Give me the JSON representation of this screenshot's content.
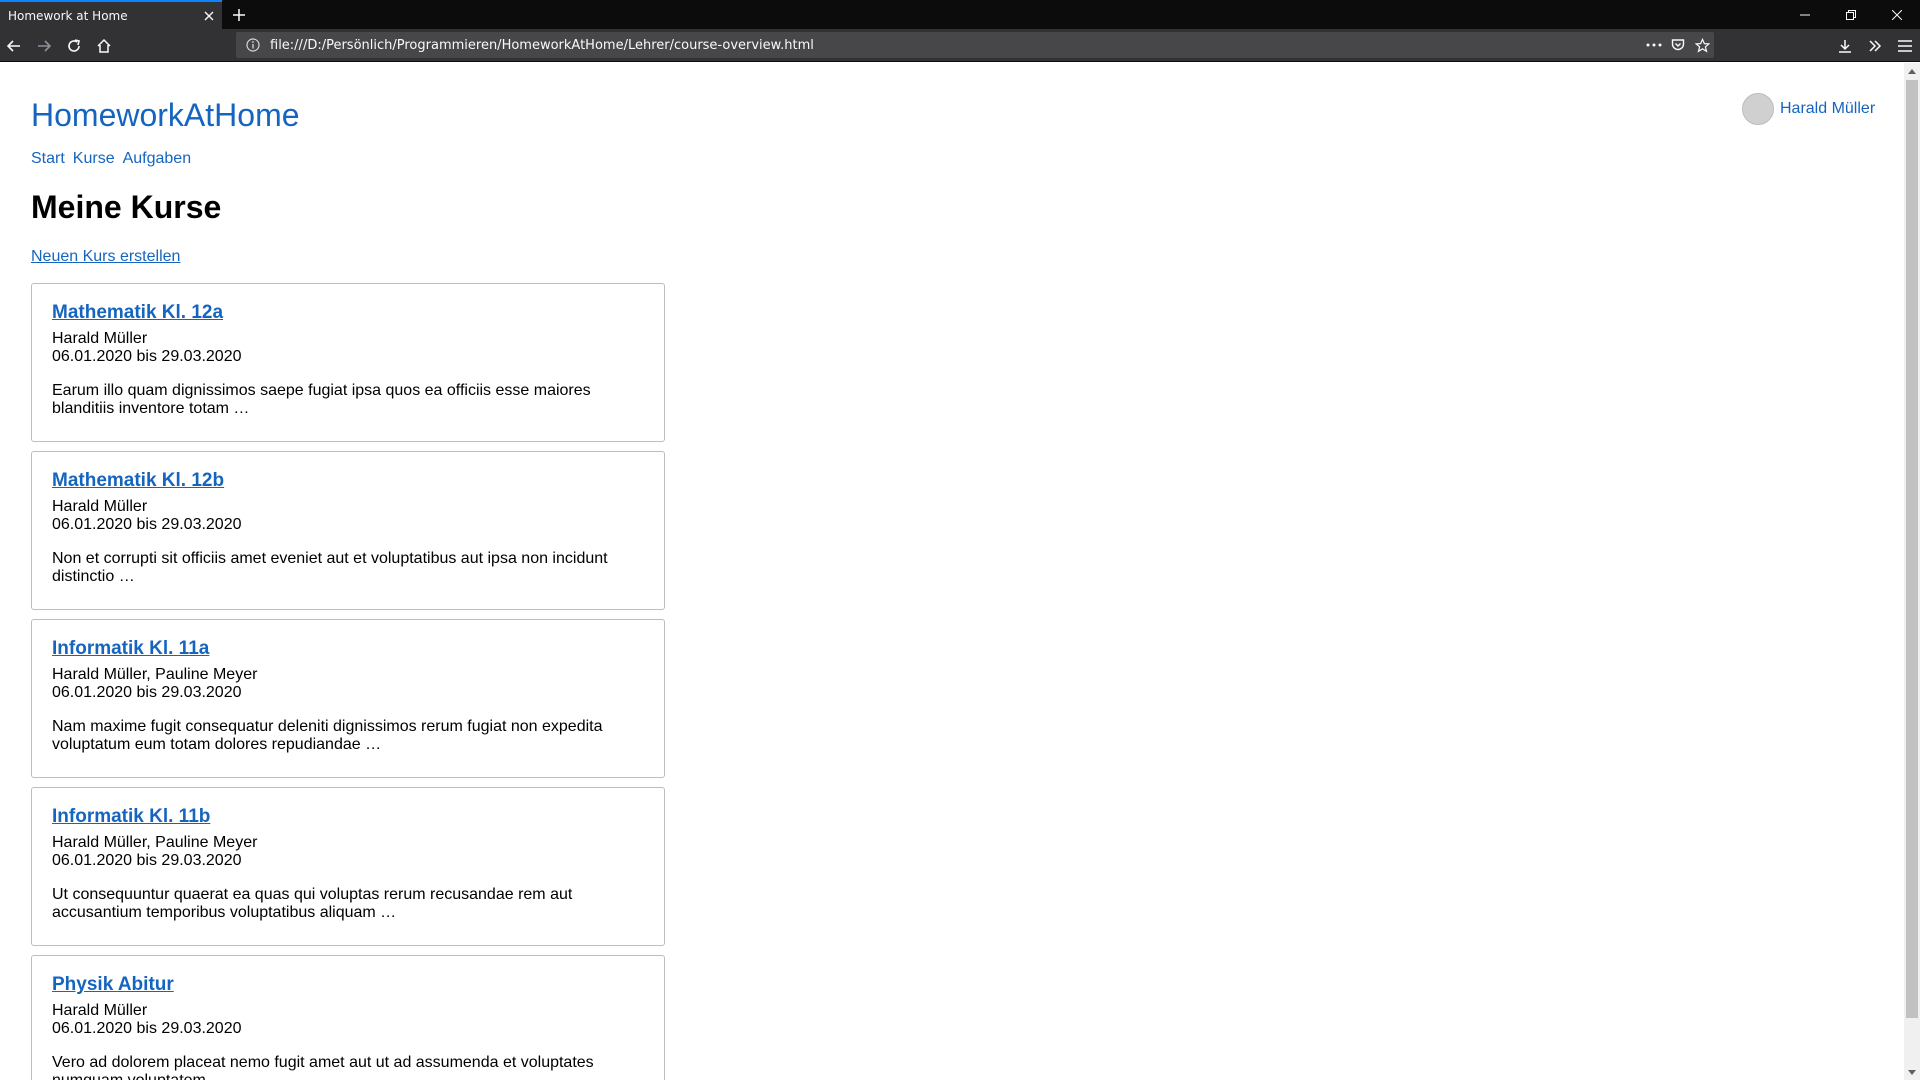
{
  "browser": {
    "tab_title": "Homework at Home",
    "url": "file:///D:/Persönlich/Programmieren/HomeworkAtHome/Lehrer/course-overview.html"
  },
  "site": {
    "brand": "HomeworkAtHome",
    "nav": [
      "Start",
      "Kurse",
      "Aufgaben"
    ],
    "user_name": "Harald Müller"
  },
  "page": {
    "title": "Meine Kurse",
    "create_link": "Neuen Kurs erstellen"
  },
  "courses": [
    {
      "title": "Mathematik Kl. 12a",
      "teachers": "Harald Müller",
      "dates": "06.01.2020 bis 29.03.2020",
      "description": "Earum illo quam dignissimos saepe fugiat ipsa quos ea officiis esse maiores blanditiis inventore totam …"
    },
    {
      "title": "Mathematik Kl. 12b",
      "teachers": "Harald Müller",
      "dates": "06.01.2020 bis 29.03.2020",
      "description": "Non et corrupti sit officiis amet eveniet aut et voluptatibus aut ipsa non incidunt distinctio …"
    },
    {
      "title": "Informatik Kl. 11a",
      "teachers": "Harald Müller, Pauline Meyer",
      "dates": "06.01.2020 bis 29.03.2020",
      "description": "Nam maxime fugit consequatur deleniti dignissimos rerum fugiat non expedita voluptatum eum totam dolores repudiandae …"
    },
    {
      "title": "Informatik Kl. 11b",
      "teachers": "Harald Müller, Pauline Meyer",
      "dates": "06.01.2020 bis 29.03.2020",
      "description": "Ut consequuntur quaerat ea quas qui voluptas rerum recusandae rem aut accusantium temporibus voluptatibus aliquam …"
    },
    {
      "title": "Physik Abitur",
      "teachers": "Harald Müller",
      "dates": "06.01.2020 bis 29.03.2020",
      "description": "Vero ad dolorem placeat nemo fugit amet aut ut ad assumenda et voluptates numquam voluptatem"
    }
  ],
  "colors": {
    "link": "#1565c0",
    "chrome_dark": "#0c0c0d",
    "chrome_toolbar": "#323234",
    "tab_accent": "#0a84ff"
  }
}
